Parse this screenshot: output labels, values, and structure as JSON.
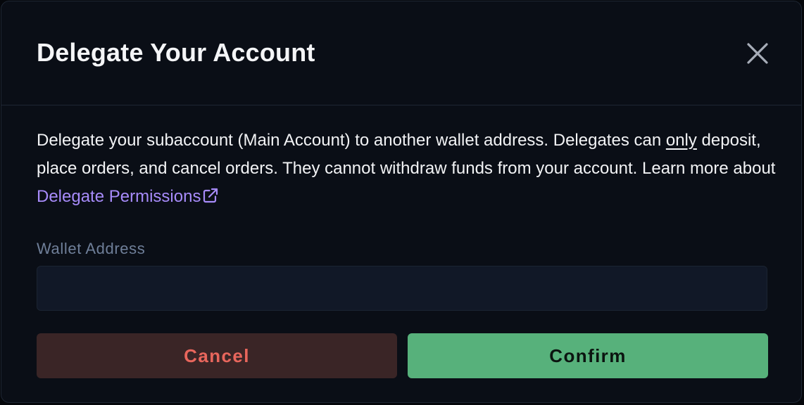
{
  "dialog": {
    "title": "Delegate Your Account",
    "description": {
      "part1": "Delegate your subaccount (Main Account) to another wallet address. Delegates can ",
      "emphasis": "only",
      "part2": " deposit, place orders, and cancel orders. They cannot withdraw funds from your account. Learn more about ",
      "link_label": "Delegate Permissions"
    },
    "wallet_field": {
      "label": "Wallet Address",
      "value": "",
      "placeholder": ""
    },
    "buttons": {
      "cancel_label": "Cancel",
      "confirm_label": "Confirm"
    },
    "icons": {
      "close": "close-icon",
      "external_link": "external-link-icon"
    },
    "colors": {
      "link": "#a78bfa",
      "cancel_text": "#e8665c",
      "cancel_bg": "#3a2526",
      "confirm_bg": "#57b17b"
    }
  }
}
